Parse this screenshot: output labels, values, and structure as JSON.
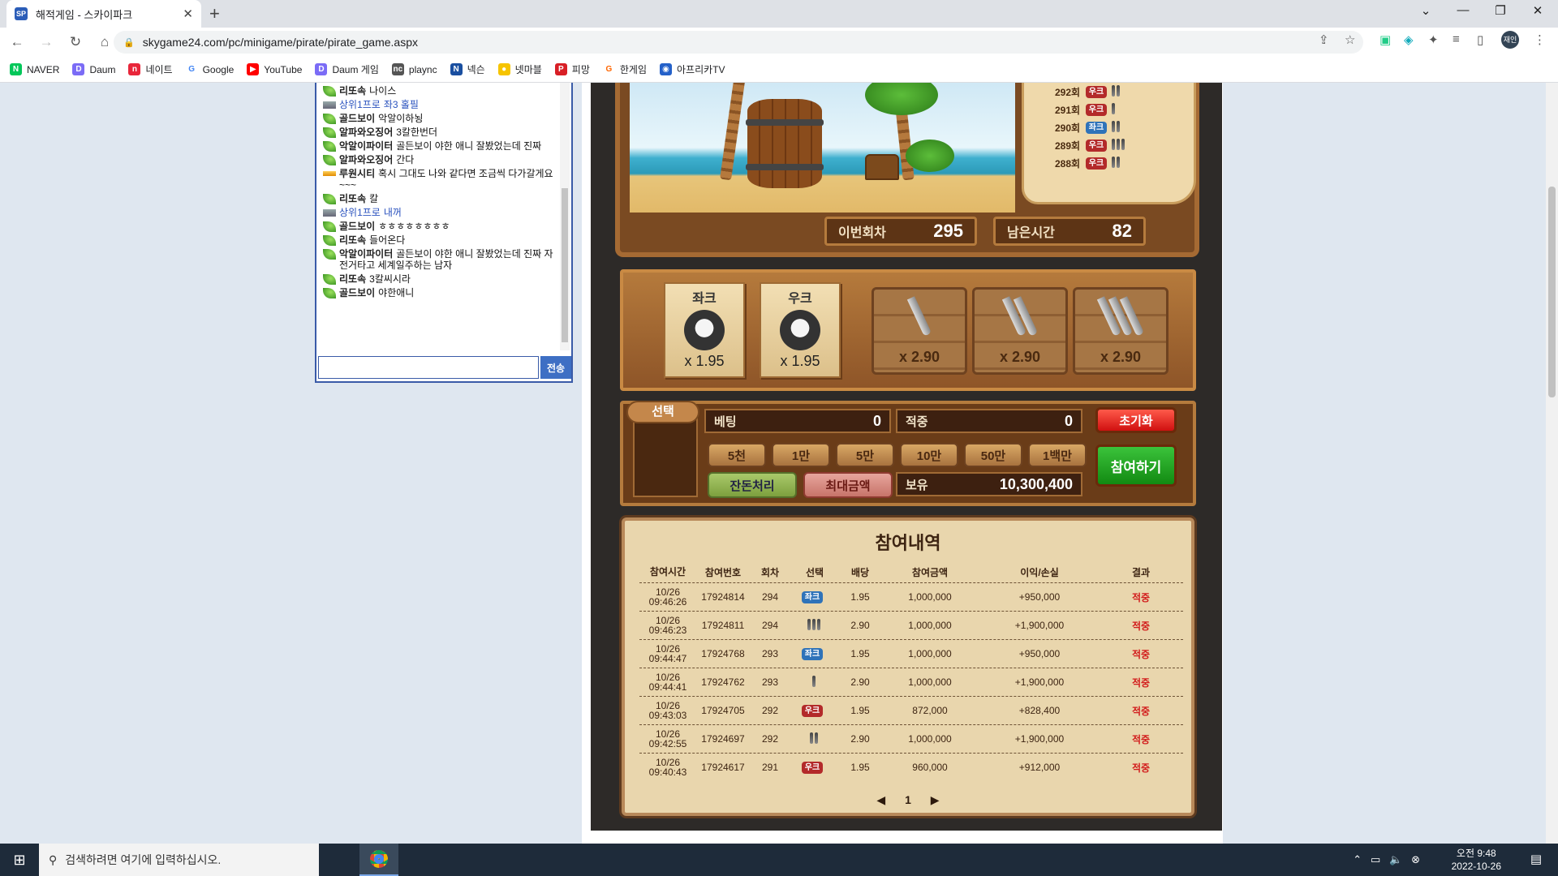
{
  "browser": {
    "tab_title": "해적게임 - 스카이파크",
    "tab_favicon": "SP",
    "tab_close": "✕",
    "new_tab": "+",
    "url": "skygame24.com/pc/minigame/pirate/pirate_game.aspx",
    "profile": "재인",
    "bookmarks": [
      "NAVER",
      "Daum",
      "네이트",
      "Google",
      "YouTube",
      "Daum 게임",
      "plaync",
      "넥슨",
      "넷마블",
      "피망",
      "한게임",
      "아프리카TV"
    ]
  },
  "chat": {
    "messages": [
      {
        "icon": "leaf",
        "name": "리또속",
        "text": "나이스",
        "name_blue": false
      },
      {
        "icon": "mod",
        "name": "상위1프로",
        "text": "좌3 홀필",
        "name_blue": true
      },
      {
        "icon": "leaf",
        "name": "골드보이",
        "text": "악알이하뇡",
        "name_blue": false
      },
      {
        "icon": "leaf",
        "name": "알파와오징어",
        "text": "3칼한번더",
        "name_blue": false
      },
      {
        "icon": "leaf",
        "name": "악알이파이터",
        "text": "골든보이 야한 애니 잘봤었는데 진짜",
        "name_blue": false
      },
      {
        "icon": "leaf",
        "name": "알파와오징어",
        "text": "간다",
        "name_blue": false
      },
      {
        "icon": "gold",
        "name": "루원시티",
        "text": "혹시 그대도 나와 같다면 조금씩 다가갈게요~~~",
        "name_blue": false
      },
      {
        "icon": "leaf",
        "name": "리또속",
        "text": "칼",
        "name_blue": false
      },
      {
        "icon": "mod",
        "name": "상위1프로",
        "text": "내꺼",
        "name_blue": true
      },
      {
        "icon": "leaf",
        "name": "골드보이",
        "text": "ㅎㅎㅎㅎㅎㅎㅎㅎ",
        "name_blue": false
      },
      {
        "icon": "leaf",
        "name": "리또속",
        "text": "들어온다",
        "name_blue": false
      },
      {
        "icon": "leaf",
        "name": "악알이파이터",
        "text": "골든보이 야한 애니 잘봤었는데 진짜 자전거타고 세계일주하는 남자",
        "name_blue": false
      },
      {
        "icon": "leaf",
        "name": "리또속",
        "text": "3칼씨시라",
        "name_blue": false
      },
      {
        "icon": "leaf",
        "name": "골드보이",
        "text": "야한애니",
        "name_blue": false
      }
    ],
    "send_label": "전송"
  },
  "game": {
    "history": [
      {
        "round": "292회",
        "side": "우크",
        "knives": 2
      },
      {
        "round": "291회",
        "side": "우크",
        "knives": 1
      },
      {
        "round": "290회",
        "side": "좌크",
        "knives": 2
      },
      {
        "round": "289회",
        "side": "우크",
        "knives": 3
      },
      {
        "round": "288회",
        "side": "우크",
        "knives": 2
      }
    ],
    "current_round_label": "이번회차",
    "current_round": "295",
    "remaining_label": "남은시간",
    "remaining": "82",
    "options": [
      {
        "label": "좌크",
        "odds": "x 1.95"
      },
      {
        "label": "우크",
        "odds": "x 1.95"
      }
    ],
    "knife_options": [
      {
        "knives": 1,
        "odds": "x 2.90"
      },
      {
        "knives": 2,
        "odds": "x 2.90"
      },
      {
        "knives": 3,
        "odds": "x 2.90"
      }
    ],
    "select_label": "선택",
    "bet_label": "베팅",
    "bet_value": "0",
    "win_label": "적중",
    "win_value": "0",
    "reset_label": "초기화",
    "chips": [
      "5천",
      "1만",
      "5만",
      "10만",
      "50만",
      "1백만"
    ],
    "join_label": "참여하기",
    "change_label": "잔돈처리",
    "max_label": "최대금액",
    "balance_label": "보유",
    "balance": "10,300,400"
  },
  "participation": {
    "title": "참여내역",
    "headers": [
      "참여시간",
      "참여번호",
      "회차",
      "선택",
      "배당",
      "참여금액",
      "이익/손실",
      "결과"
    ],
    "rows": [
      {
        "date": "10/26",
        "time": "09:46:26",
        "id": "17924814",
        "round": "294",
        "pick": "좌크",
        "odds": "1.95",
        "amount": "1,000,000",
        "pl": "+950,000",
        "result": "적중"
      },
      {
        "date": "10/26",
        "time": "09:46:23",
        "id": "17924811",
        "round": "294",
        "pick": "knife3",
        "odds": "2.90",
        "amount": "1,000,000",
        "pl": "+1,900,000",
        "result": "적중"
      },
      {
        "date": "10/26",
        "time": "09:44:47",
        "id": "17924768",
        "round": "293",
        "pick": "좌크",
        "odds": "1.95",
        "amount": "1,000,000",
        "pl": "+950,000",
        "result": "적중"
      },
      {
        "date": "10/26",
        "time": "09:44:41",
        "id": "17924762",
        "round": "293",
        "pick": "knife1",
        "odds": "2.90",
        "amount": "1,000,000",
        "pl": "+1,900,000",
        "result": "적중"
      },
      {
        "date": "10/26",
        "time": "09:43:03",
        "id": "17924705",
        "round": "292",
        "pick": "우크",
        "odds": "1.95",
        "amount": "872,000",
        "pl": "+828,400",
        "result": "적중"
      },
      {
        "date": "10/26",
        "time": "09:42:55",
        "id": "17924697",
        "round": "292",
        "pick": "knife2",
        "odds": "2.90",
        "amount": "1,000,000",
        "pl": "+1,900,000",
        "result": "적중"
      },
      {
        "date": "10/26",
        "time": "09:40:43",
        "id": "17924617",
        "round": "291",
        "pick": "우크",
        "odds": "1.95",
        "amount": "960,000",
        "pl": "+912,000",
        "result": "적중"
      }
    ],
    "page": "1"
  },
  "taskbar": {
    "search_placeholder": "검색하려면 여기에 입력하십시오.",
    "time": "오전 9:48",
    "date": "2022-10-26"
  }
}
